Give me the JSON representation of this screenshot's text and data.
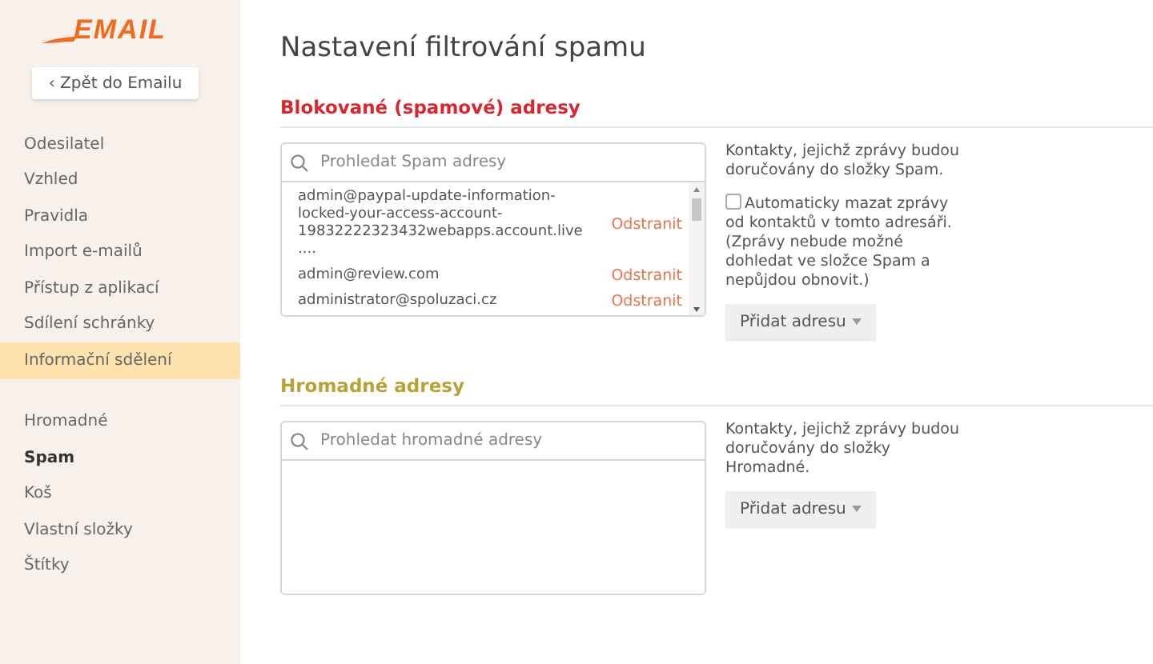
{
  "logo": "EMAIL",
  "back_button": "‹ Zpět do Emailu",
  "sidebar": {
    "groups": [
      {
        "items": [
          {
            "label": "Odesilatel",
            "highlighted": false,
            "bold": false
          },
          {
            "label": "Vzhled",
            "highlighted": false,
            "bold": false
          },
          {
            "label": "Pravidla",
            "highlighted": false,
            "bold": false
          },
          {
            "label": "Import e-mailů",
            "highlighted": false,
            "bold": false
          },
          {
            "label": "Přístup z aplikací",
            "highlighted": false,
            "bold": false
          },
          {
            "label": "Sdílení schránky",
            "highlighted": false,
            "bold": false
          },
          {
            "label": "Informační sdělení",
            "highlighted": true,
            "bold": false
          }
        ]
      },
      {
        "items": [
          {
            "label": "Hromadné",
            "highlighted": false,
            "bold": false
          },
          {
            "label": "Spam",
            "highlighted": false,
            "bold": true
          },
          {
            "label": "Koš",
            "highlighted": false,
            "bold": false
          },
          {
            "label": "Vlastní složky",
            "highlighted": false,
            "bold": false
          },
          {
            "label": "Štítky",
            "highlighted": false,
            "bold": false
          }
        ]
      }
    ]
  },
  "title": "Nastavení filtrování spamu",
  "sections": [
    {
      "heading": "Blokované (spamové) adresy",
      "color": "#d9272e",
      "search": {
        "placeholder": "Prohledat Spam adresy"
      },
      "rows": [
        {
          "address": "admin@paypal-update-information-locked-your-access-account-19832222323432webapps.account.live....",
          "action": "Odstranit"
        },
        {
          "address": "admin@review.com",
          "action": "Odstranit"
        },
        {
          "address": "administrator@spoluzaci.cz",
          "action": "Odstranit"
        }
      ],
      "description": "Kontakty, jejichž zprávy budou doručovány do složky Spam.",
      "option": {
        "label": "Automaticky mazat zprávy od kontaktů v tomto adresáři. (Zprávy nebude možné dohledat ve složce Spam a nepůjdou obnovit.)",
        "checked": false
      },
      "button": "Přidat adresu"
    },
    {
      "heading": "Hromadné adresy",
      "color": "#b8a235",
      "search": {
        "placeholder": "Prohledat hromadné adresy"
      },
      "description": "Kontakty, jejichž zprávy budou doručovány do složky Hromadné.",
      "button": "Přidat adresu"
    }
  ]
}
